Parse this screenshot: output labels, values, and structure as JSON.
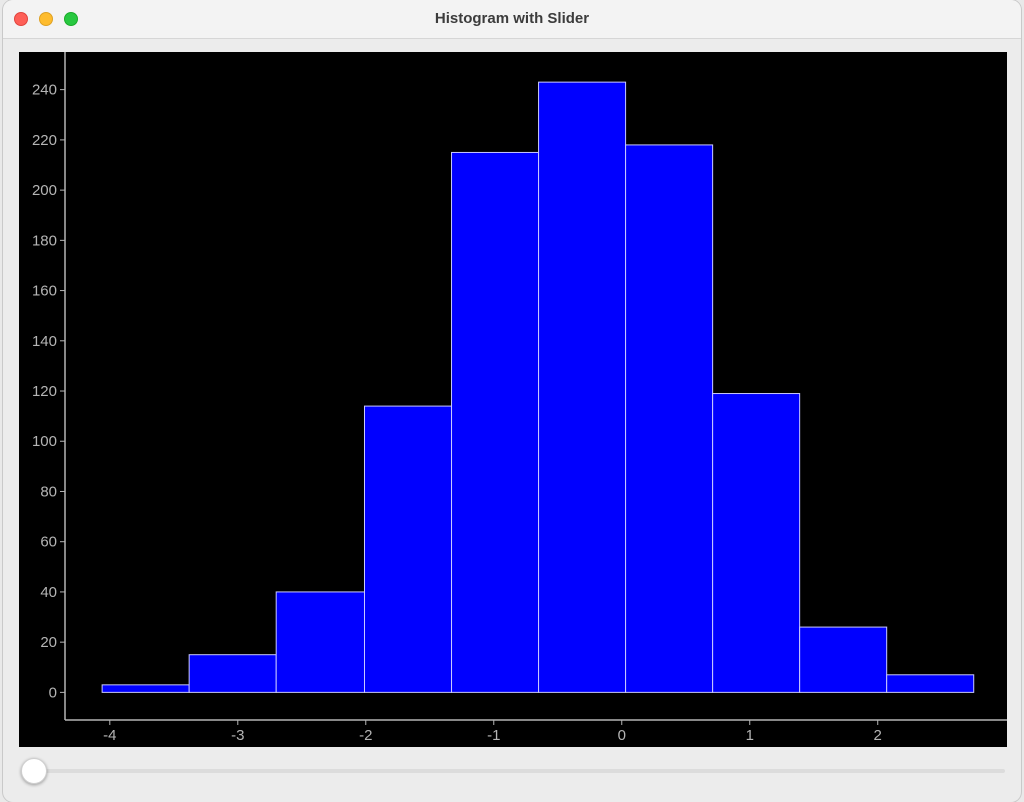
{
  "window": {
    "title": "Histogram with Slider"
  },
  "slider": {
    "value": 0
  },
  "colors": {
    "bar_fill": "#0000ff",
    "bar_edge": "#c9c9ff",
    "axis": "#b5b5b5",
    "background": "#000000"
  },
  "chart_data": {
    "type": "bar",
    "bin_edges": [
      -4.06,
      -3.38,
      -2.7,
      -2.01,
      -1.33,
      -0.65,
      0.03,
      0.71,
      1.39,
      2.07,
      2.75
    ],
    "values": [
      3,
      15,
      40,
      114,
      215,
      243,
      218,
      119,
      26,
      7
    ],
    "xticks": [
      -4,
      -3,
      -2,
      -1,
      0,
      1,
      2
    ],
    "xtick_labels": [
      "-4",
      "-3",
      "-2",
      "-1",
      "0",
      "1",
      "2"
    ],
    "yticks": [
      0,
      20,
      40,
      60,
      80,
      100,
      120,
      140,
      160,
      180,
      200,
      220,
      240
    ],
    "ytick_labels": [
      "0",
      "20",
      "40",
      "60",
      "80",
      "100",
      "120",
      "140",
      "160",
      "180",
      "200",
      "220",
      "240"
    ],
    "xlim": [
      -4.35,
      3.01
    ],
    "ylim": [
      -11,
      255
    ],
    "grid": false
  }
}
